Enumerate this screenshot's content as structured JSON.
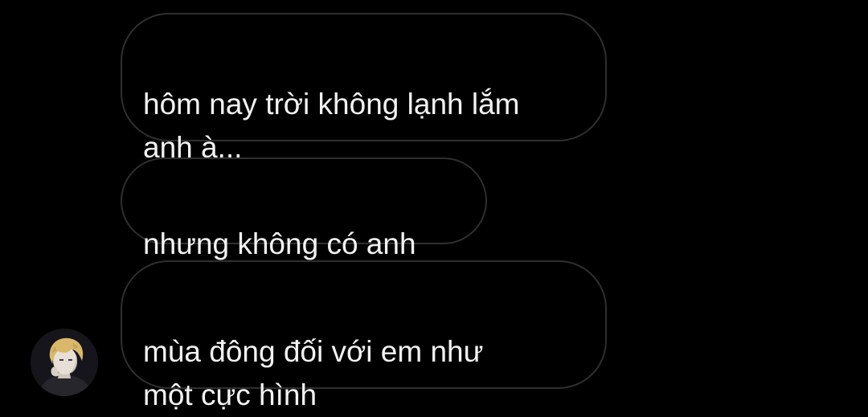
{
  "messages": [
    {
      "text": "hôm nay trời không lạnh lắm\nanh à..."
    },
    {
      "text": "nhưng không có anh"
    },
    {
      "text": "mùa đông đối với em như\nmột cực hình"
    }
  ],
  "avatar": {
    "icon": "user-avatar-anime-portrait"
  },
  "colors": {
    "background": "#000000",
    "bubble_border": "#2f2f2f",
    "text": "#f2f2f2"
  }
}
